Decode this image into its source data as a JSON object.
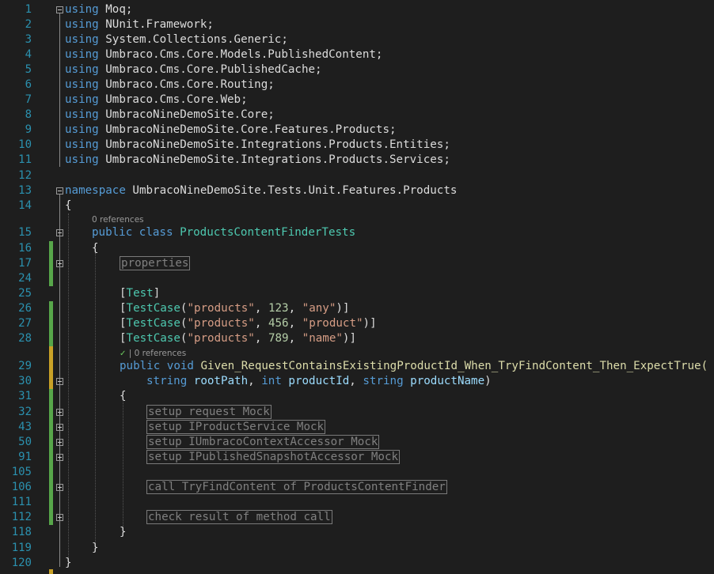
{
  "gutter": {
    "line_numbers": [
      "1",
      "2",
      "3",
      "4",
      "5",
      "6",
      "7",
      "8",
      "9",
      "10",
      "11",
      "12",
      "13",
      "14",
      "15",
      "16",
      "17",
      "24",
      "25",
      "26",
      "27",
      "28",
      "29",
      "30",
      "31",
      "32",
      "43",
      "50",
      "91",
      "105",
      "106",
      "111",
      "112",
      "118",
      "119",
      "120"
    ]
  },
  "code": {
    "usings": [
      {
        "kw": "using",
        "ns": "Moq;"
      },
      {
        "kw": "using",
        "ns": "NUnit.Framework;"
      },
      {
        "kw": "using",
        "ns": "System.Collections.Generic;"
      },
      {
        "kw": "using",
        "ns": "Umbraco.Cms.Core.Models.PublishedContent;"
      },
      {
        "kw": "using",
        "ns": "Umbraco.Cms.Core.PublishedCache;"
      },
      {
        "kw": "using",
        "ns": "Umbraco.Cms.Core.Routing;"
      },
      {
        "kw": "using",
        "ns": "Umbraco.Cms.Core.Web;"
      },
      {
        "kw": "using",
        "ns": "UmbracoNineDemoSite.Core;"
      },
      {
        "kw": "using",
        "ns": "UmbracoNineDemoSite.Core.Features.Products;"
      },
      {
        "kw": "using",
        "ns": "UmbracoNineDemoSite.Integrations.Products.Entities;"
      },
      {
        "kw": "using",
        "ns": "UmbracoNineDemoSite.Integrations.Products.Services;"
      }
    ],
    "namespace_kw": "namespace",
    "namespace_name": "UmbracoNineDemoSite.Tests.Unit.Features.Products",
    "brace_open": "{",
    "brace_close": "}",
    "class_refs": "0 references",
    "public_kw": "public",
    "class_kw": "class",
    "class_name": "ProductsContentFinderTests",
    "region_properties": "properties",
    "attr_open": "[",
    "attr_close": "]",
    "test_attr": "Test",
    "testcase_attr": "TestCase",
    "testcases": [
      {
        "s1": "\"products\"",
        "n": "123",
        "s2": "\"any\""
      },
      {
        "s1": "\"products\"",
        "n": "456",
        "s2": "\"product\""
      },
      {
        "s1": "\"products\"",
        "n": "789",
        "s2": "\"name\""
      }
    ],
    "method_check": "✓",
    "method_refs": "| 0 references",
    "void_kw": "void",
    "method_name": "Given_RequestContainsExistingProductId_When_TryFindContent_Then_ExpectTrue(",
    "param_string_kw": "string",
    "param_int_kw": "int",
    "param_rootPath": "rootPath",
    "param_productId": "productId",
    "param_productName": "productName",
    "regions": [
      "setup request Mock",
      "setup IProductService Mock",
      "setup IUmbracoContextAccessor Mock",
      "setup IPublishedSnapshotAccessor Mock",
      "call TryFindContent of ProductsContentFinder",
      "check result of method call"
    ]
  },
  "colors": {
    "background": "#1e1e1e",
    "line_number": "#2b91af",
    "keyword": "#569cd6",
    "type": "#4ec9b0",
    "string": "#d69d85",
    "number": "#b5cea8",
    "parameter": "#9cdcfe",
    "method": "#dcdcaa",
    "change_saved": "#57a64a",
    "change_unsaved": "#c9a227"
  },
  "icons": [
    "fold-minus-icon",
    "fold-plus-icon",
    "check-icon"
  ]
}
